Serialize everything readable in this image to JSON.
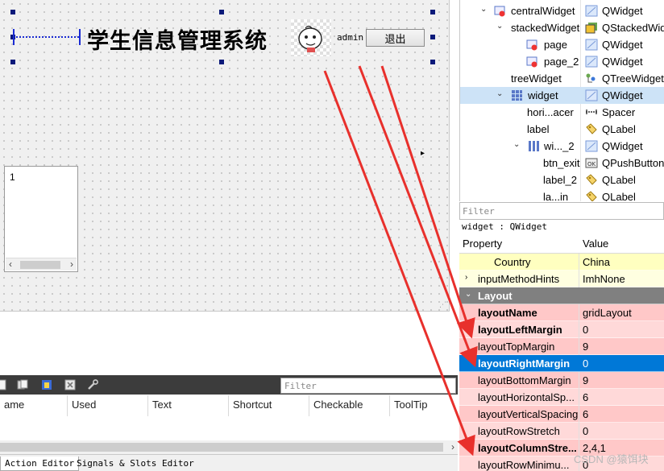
{
  "canvas": {
    "title_text": "学生信息管理系统",
    "admin_label": "admin",
    "exit_button": "退出",
    "tree_item": "1",
    "tree_scroll_left": "‹",
    "tree_scroll_right": "›"
  },
  "object_inspector": {
    "rows": [
      {
        "name": "centralWidget",
        "class": "QWidget",
        "expander": "v"
      },
      {
        "name": "stackedWidget",
        "class": "QStackedWid",
        "expander": "v"
      },
      {
        "name": "page",
        "class": "QWidget",
        "expander": ""
      },
      {
        "name": "page_2",
        "class": "QWidget",
        "expander": ""
      },
      {
        "name": "treeWidget",
        "class": "QTreeWidget",
        "expander": ""
      },
      {
        "name": "widget",
        "class": "QWidget",
        "expander": "v"
      },
      {
        "name": "hori...acer",
        "class": "Spacer",
        "expander": ""
      },
      {
        "name": "label",
        "class": "QLabel",
        "expander": ""
      },
      {
        "name": "wi..._2",
        "class": "QWidget",
        "expander": "v"
      },
      {
        "name": "btn_exit",
        "class": "QPushButton",
        "expander": ""
      },
      {
        "name": "label_2",
        "class": "QLabel",
        "expander": ""
      },
      {
        "name": "la...in",
        "class": "QLabel",
        "expander": ""
      }
    ]
  },
  "property_editor": {
    "filter_placeholder": "Filter",
    "context_label": "widget : QWidget",
    "header_property": "Property",
    "header_value": "Value",
    "rows": [
      {
        "name": "Country",
        "value": "China"
      },
      {
        "name": "inputMethodHints",
        "value": "ImhNone"
      },
      {
        "name": "Layout",
        "value": ""
      },
      {
        "name": "layoutName",
        "value": "gridLayout"
      },
      {
        "name": "layoutLeftMargin",
        "value": "0"
      },
      {
        "name": "layoutTopMargin",
        "value": "9"
      },
      {
        "name": "layoutRightMargin",
        "value": "0"
      },
      {
        "name": "layoutBottomMargin",
        "value": "9"
      },
      {
        "name": "layoutHorizontalSp...",
        "value": "6"
      },
      {
        "name": "layoutVerticalSpacing",
        "value": "6"
      },
      {
        "name": "layoutRowStretch",
        "value": "0"
      },
      {
        "name": "layoutColumnStre...",
        "value": "2,4,1"
      },
      {
        "name": "layoutRowMinimu...",
        "value": "0"
      }
    ]
  },
  "action_editor": {
    "filter_placeholder": "Filter",
    "columns": [
      "ame",
      "Used",
      "Text",
      "Shortcut",
      "Checkable",
      "ToolTip"
    ]
  },
  "bottom_tabs": {
    "action_editor": "Action Editor",
    "signals_slots": "Signals & Slots Editor"
  },
  "watermark": "CSDN @猿饵块",
  "colors": {
    "selection_blue": "#0078d7",
    "layout_row_pink": "#ffc8c8",
    "layout_row_pink_alt": "#ffd9d9",
    "country_row_yellow": "#ffffc0",
    "section_gray": "#808080",
    "arrow_red": "#e8302c",
    "handle_navy": "#0b1a7a"
  }
}
